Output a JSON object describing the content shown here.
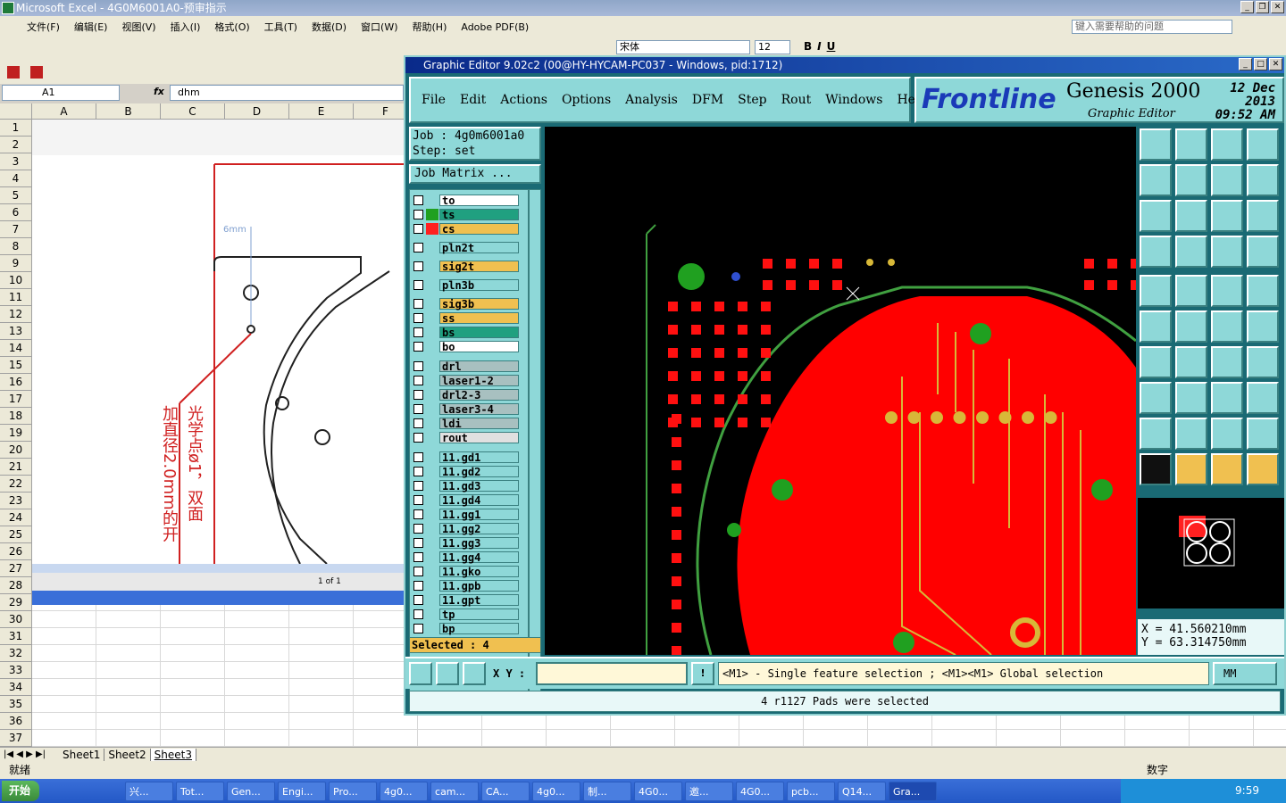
{
  "excel": {
    "title": "Microsoft Excel - 4G0M6001A0-预审指示",
    "menu": [
      "文件(F)",
      "编辑(E)",
      "视图(V)",
      "插入(I)",
      "格式(O)",
      "工具(T)",
      "数据(D)",
      "窗口(W)",
      "帮助(H)",
      "Adobe PDF(B)"
    ],
    "help_placeholder": "键入需要帮助的问题",
    "font_name": "宋体",
    "font_size": "12",
    "name_box": "A1",
    "fx": "fx",
    "formula": "dhm",
    "columns": [
      "A",
      "B",
      "C",
      "D",
      "E",
      "F"
    ],
    "rows": [
      "1",
      "2",
      "3",
      "4",
      "5",
      "6",
      "7",
      "8",
      "9",
      "10",
      "11",
      "12",
      "13",
      "14",
      "15",
      "16",
      "17",
      "18",
      "19",
      "20",
      "21",
      "22",
      "23",
      "24",
      "25",
      "26",
      "27",
      "28",
      "29",
      "30",
      "31",
      "32",
      "33",
      "34",
      "35",
      "36",
      "37"
    ],
    "sheets": [
      "Sheet1",
      "Sheet2",
      "Sheet3"
    ],
    "status": "就绪",
    "status_right": "数字",
    "drawing_dim": "6mm",
    "drawing_note_1": "光学点ø1，双面",
    "drawing_note_2": "加直径2.0mm的开",
    "pager": "1 of 1"
  },
  "genesis": {
    "title": "Graphic Editor 9.02c2 (00@HY-HYCAM-PC037 - Windows, pid:1712)",
    "menu": [
      "File",
      "Edit",
      "Actions",
      "Options",
      "Analysis",
      "DFM",
      "Step",
      "Rout",
      "Windows",
      "Help"
    ],
    "brand_logo": "Frontline",
    "brand_name": "Genesis 2000",
    "brand_sub": "Graphic Editor",
    "brand_date": "12 Dec 2013",
    "brand_time": "09:52 AM",
    "job": "Job : 4g0m6001a0",
    "step": "Step: set",
    "job_matrix": "Job Matrix ...",
    "layers": [
      {
        "name": "to",
        "color": "#ffffff"
      },
      {
        "name": "ts",
        "color": "#20a080"
      },
      {
        "name": "cs",
        "color": "#f0c050"
      },
      {
        "name": "pln2t",
        "color": "#8ed8d8"
      },
      {
        "name": "sig2t",
        "color": "#f0c050"
      },
      {
        "name": "pln3b",
        "color": "#8ed8d8"
      },
      {
        "name": "sig3b",
        "color": "#f0c050"
      },
      {
        "name": "ss",
        "color": "#f0c050"
      },
      {
        "name": "bs",
        "color": "#20a080"
      },
      {
        "name": "bo",
        "color": "#ffffff"
      },
      {
        "name": "drl",
        "color": "#a8c0c0"
      },
      {
        "name": "laser1-2",
        "color": "#a8c0c0"
      },
      {
        "name": "drl2-3",
        "color": "#a8c0c0"
      },
      {
        "name": "laser3-4",
        "color": "#a8c0c0"
      },
      {
        "name": "ldi",
        "color": "#a8c0c0"
      },
      {
        "name": "rout",
        "color": "#e0e0e0"
      },
      {
        "name": "11.gd1",
        "color": "#8ed8d8"
      },
      {
        "name": "11.gd2",
        "color": "#8ed8d8"
      },
      {
        "name": "11.gd3",
        "color": "#8ed8d8"
      },
      {
        "name": "11.gd4",
        "color": "#8ed8d8"
      },
      {
        "name": "11.gg1",
        "color": "#8ed8d8"
      },
      {
        "name": "11.gg2",
        "color": "#8ed8d8"
      },
      {
        "name": "11.gg3",
        "color": "#8ed8d8"
      },
      {
        "name": "11.gg4",
        "color": "#8ed8d8"
      },
      {
        "name": "11.gko",
        "color": "#8ed8d8"
      },
      {
        "name": "11.gpb",
        "color": "#8ed8d8"
      },
      {
        "name": "11.gpt",
        "color": "#8ed8d8"
      },
      {
        "name": "tp",
        "color": "#8ed8d8"
      },
      {
        "name": "bp",
        "color": "#8ed8d8"
      }
    ],
    "selected": "Selected : 4",
    "coord_x": "X = 41.560210mm",
    "coord_y": "Y = 63.314750mm",
    "xy_label": "X Y :",
    "hint": "<M1> - Single feature selection ; <M1><M1> Global selection",
    "units": "MM",
    "status": "4 r1127 Pads were selected"
  },
  "taskbar": {
    "start": "开始",
    "tasks": [
      "兴...",
      "Tot...",
      "Gen...",
      "Engi...",
      "Pro...",
      "4g0...",
      "cam...",
      "CA...",
      "4g0...",
      "制...",
      "4G0...",
      "邀...",
      "4G0...",
      "pcb...",
      "Q14...",
      "Gra..."
    ],
    "clock": "9:59"
  },
  "colors": {
    "board": "#ff0000",
    "pad": "#ff1010",
    "trace": "#d8b838",
    "via": "#20a020",
    "outline": "#40a040"
  }
}
